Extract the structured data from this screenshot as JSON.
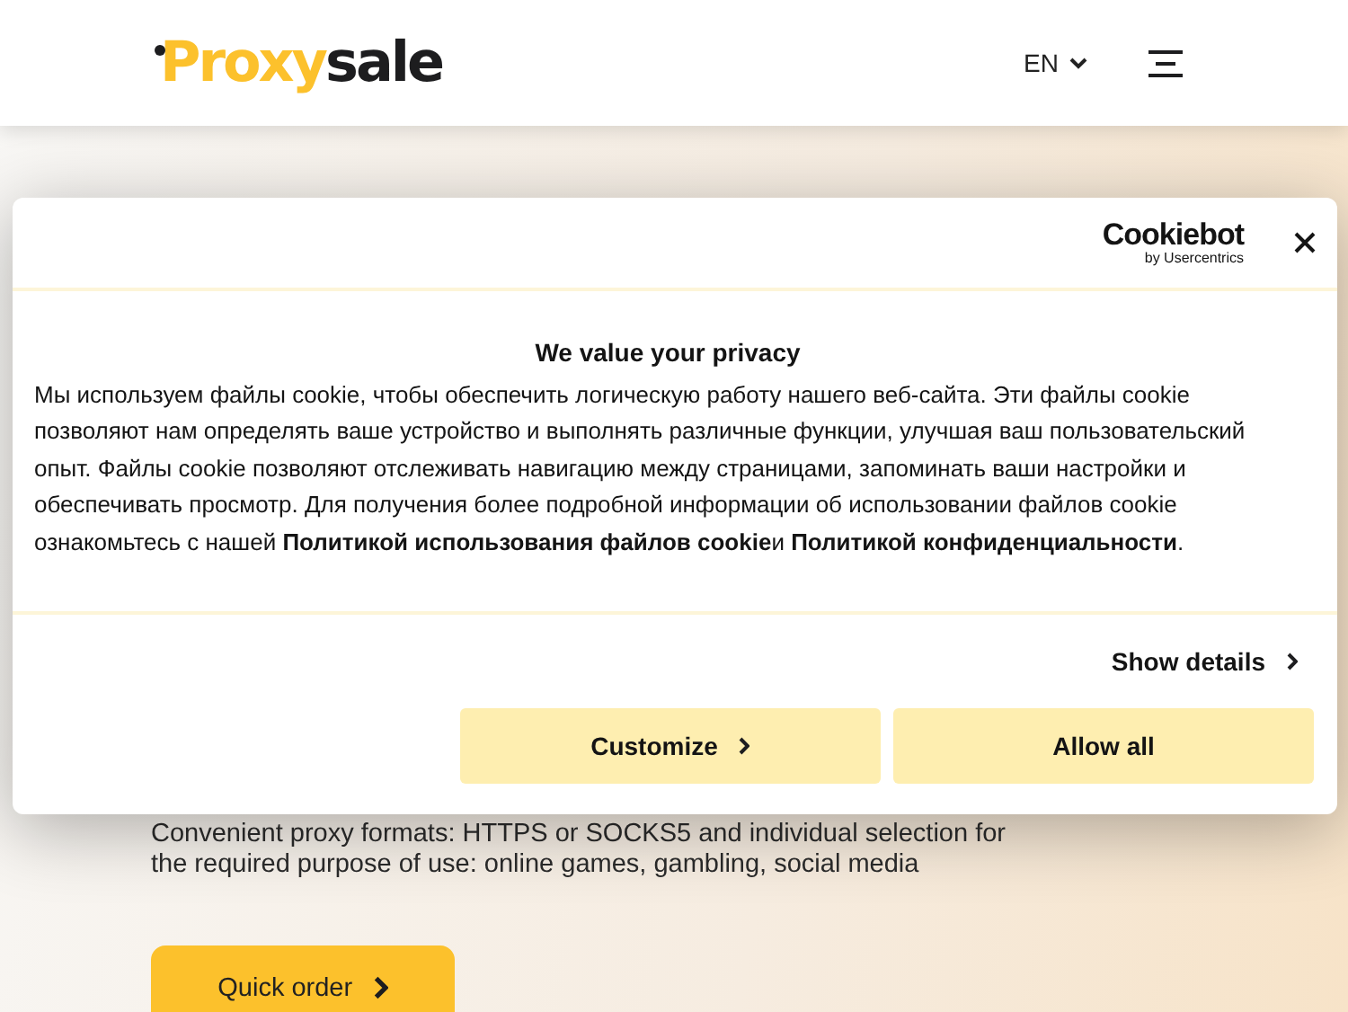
{
  "header": {
    "logo": {
      "part_1": "Proxy",
      "part_2": "sale"
    },
    "language": "EN"
  },
  "hero": {
    "description": "Convenient proxy formats: HTTPS or SOCKS5 and individual selection for the required purpose of use: online games, gambling, social media",
    "button": "Quick order"
  },
  "cookie_dialog": {
    "brand": {
      "name": "Cookiebot",
      "byline": "by Usercentrics"
    },
    "title": "We value your privacy",
    "text": [
      {
        "kind": "text",
        "text": "Мы используем файлы cookie, чтобы обеспечить логическую работу нашего веб-сайта. Эти файлы cookie позволяют нам определять ваше устройство и выполнять различные функции, улучшая ваш пользовательский опыт. Файлы cookie позволяют отслеживать навигацию между страницами, запоминать ваши настройки и обеспечивать просмотр. Для получения более подробной информации об использовании файлов cookie ознакомьтесь с нашей "
      },
      {
        "kind": "link",
        "text": "Политикой использования файлов cookie"
      },
      {
        "kind": "text",
        "text": "и "
      },
      {
        "kind": "link",
        "text": "Политикой конфиденциальности"
      },
      {
        "kind": "text",
        "text": "."
      }
    ],
    "show_details": "Show details",
    "buttons": [
      {
        "label": "Customize",
        "kind": "chevron"
      },
      {
        "label": "Allow all",
        "kind": "plain"
      }
    ]
  }
}
